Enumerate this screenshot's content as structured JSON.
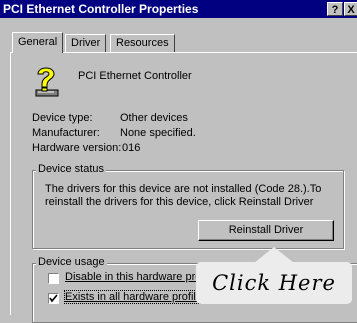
{
  "window": {
    "title": "PCI Ethernet Controller Properties",
    "help_button": "?",
    "close_button": "X"
  },
  "tabs": [
    {
      "label": "General",
      "active": true
    },
    {
      "label": "Driver",
      "active": false
    },
    {
      "label": "Resources",
      "active": false
    }
  ],
  "device": {
    "icon": "unknown-device-question-icon",
    "name": "PCI Ethernet Controller",
    "type_label": "Device type:",
    "type_value": "Other devices",
    "manufacturer_label": "Manufacturer:",
    "manufacturer_value": "None specified.",
    "hardware_version_label": "Hardware version:",
    "hardware_version_value": "016"
  },
  "device_status": {
    "legend": "Device status",
    "message": "The drivers for this device are not installed  (Code 28.).To reinstall the drivers for this device, click Reinstall Driver",
    "button_label": "Reinstall Driver"
  },
  "device_usage": {
    "legend": "Device usage",
    "options": [
      {
        "label": "Disable in this hardware pro",
        "checked": false
      },
      {
        "label": "Exists in all hardware profile",
        "checked": true
      }
    ]
  },
  "callout": {
    "text": "Click  Here"
  },
  "colors": {
    "titlebar": "#000080",
    "face": "#c0c0c0",
    "callout": "#ececec"
  }
}
